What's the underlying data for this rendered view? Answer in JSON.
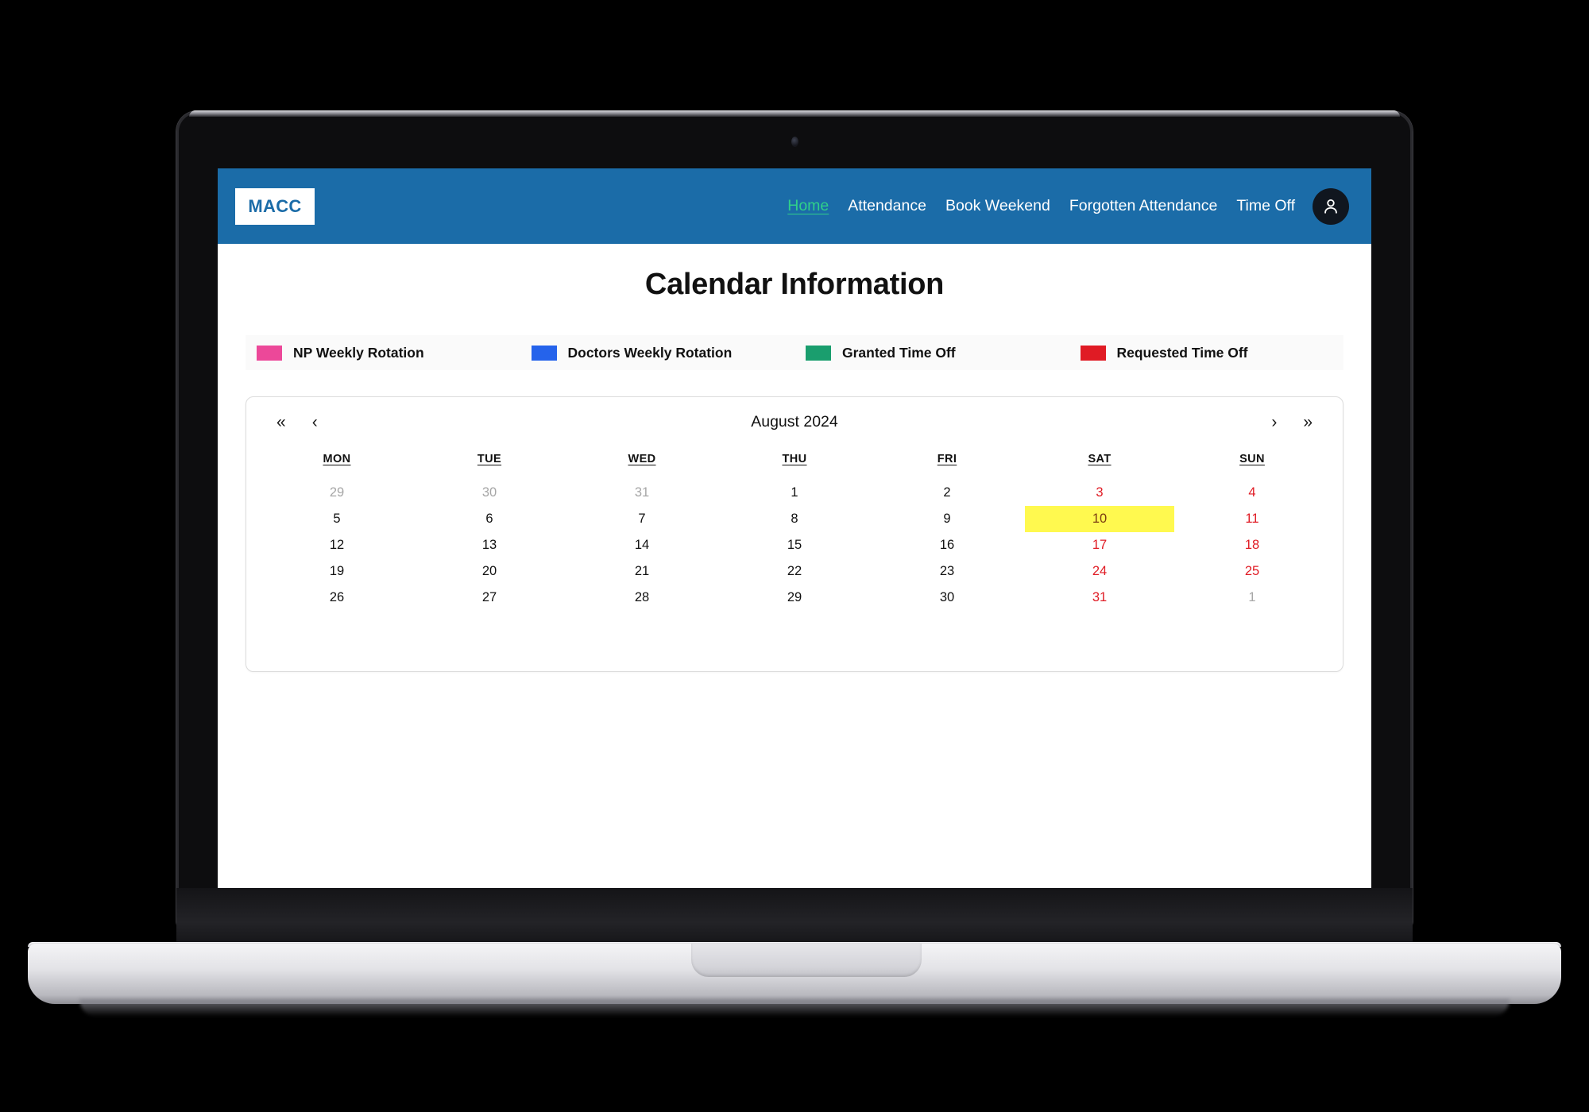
{
  "navbar": {
    "brand": "MACC",
    "links": [
      {
        "label": "Home",
        "active": true
      },
      {
        "label": "Attendance",
        "active": false
      },
      {
        "label": "Book Weekend",
        "active": false
      },
      {
        "label": "Forgotten Attendance",
        "active": false
      },
      {
        "label": "Time Off",
        "active": false
      }
    ],
    "avatar_icon": "user-avatar-icon",
    "background_color": "#1b6ca8",
    "active_link_color": "#2fd08a"
  },
  "page": {
    "title": "Calendar Information"
  },
  "legend": {
    "items": [
      {
        "label": "NP Weekly Rotation",
        "color": "#ec4899"
      },
      {
        "label": "Doctors Weekly Rotation",
        "color": "#2563eb"
      },
      {
        "label": "Granted Time Off",
        "color": "#1a9e6e"
      },
      {
        "label": "Requested Time Off",
        "color": "#e01b24"
      }
    ]
  },
  "calendar": {
    "title": "August 2024",
    "nav": {
      "first": "«",
      "prev": "‹",
      "next": "›",
      "last": "»"
    },
    "weekdays": [
      "MON",
      "TUE",
      "WED",
      "THU",
      "FRI",
      "SAT",
      "SUN"
    ],
    "weeks": [
      [
        {
          "day": "29",
          "type": "muted"
        },
        {
          "day": "30",
          "type": "muted"
        },
        {
          "day": "31",
          "type": "muted"
        },
        {
          "day": "1",
          "type": "normal"
        },
        {
          "day": "2",
          "type": "normal"
        },
        {
          "day": "3",
          "type": "weekend"
        },
        {
          "day": "4",
          "type": "weekend"
        }
      ],
      [
        {
          "day": "5",
          "type": "normal"
        },
        {
          "day": "6",
          "type": "normal"
        },
        {
          "day": "7",
          "type": "normal"
        },
        {
          "day": "8",
          "type": "normal"
        },
        {
          "day": "9",
          "type": "normal"
        },
        {
          "day": "10",
          "type": "today"
        },
        {
          "day": "11",
          "type": "weekend"
        }
      ],
      [
        {
          "day": "12",
          "type": "normal"
        },
        {
          "day": "13",
          "type": "normal"
        },
        {
          "day": "14",
          "type": "normal"
        },
        {
          "day": "15",
          "type": "normal"
        },
        {
          "day": "16",
          "type": "normal"
        },
        {
          "day": "17",
          "type": "weekend"
        },
        {
          "day": "18",
          "type": "weekend"
        }
      ],
      [
        {
          "day": "19",
          "type": "normal"
        },
        {
          "day": "20",
          "type": "normal"
        },
        {
          "day": "21",
          "type": "normal"
        },
        {
          "day": "22",
          "type": "normal"
        },
        {
          "day": "23",
          "type": "normal"
        },
        {
          "day": "24",
          "type": "weekend"
        },
        {
          "day": "25",
          "type": "weekend"
        }
      ],
      [
        {
          "day": "26",
          "type": "normal"
        },
        {
          "day": "27",
          "type": "normal"
        },
        {
          "day": "28",
          "type": "normal"
        },
        {
          "day": "29",
          "type": "normal"
        },
        {
          "day": "30",
          "type": "normal"
        },
        {
          "day": "31",
          "type": "weekend"
        },
        {
          "day": "1",
          "type": "muted"
        }
      ]
    ],
    "highlight_color": "#fff94f"
  }
}
